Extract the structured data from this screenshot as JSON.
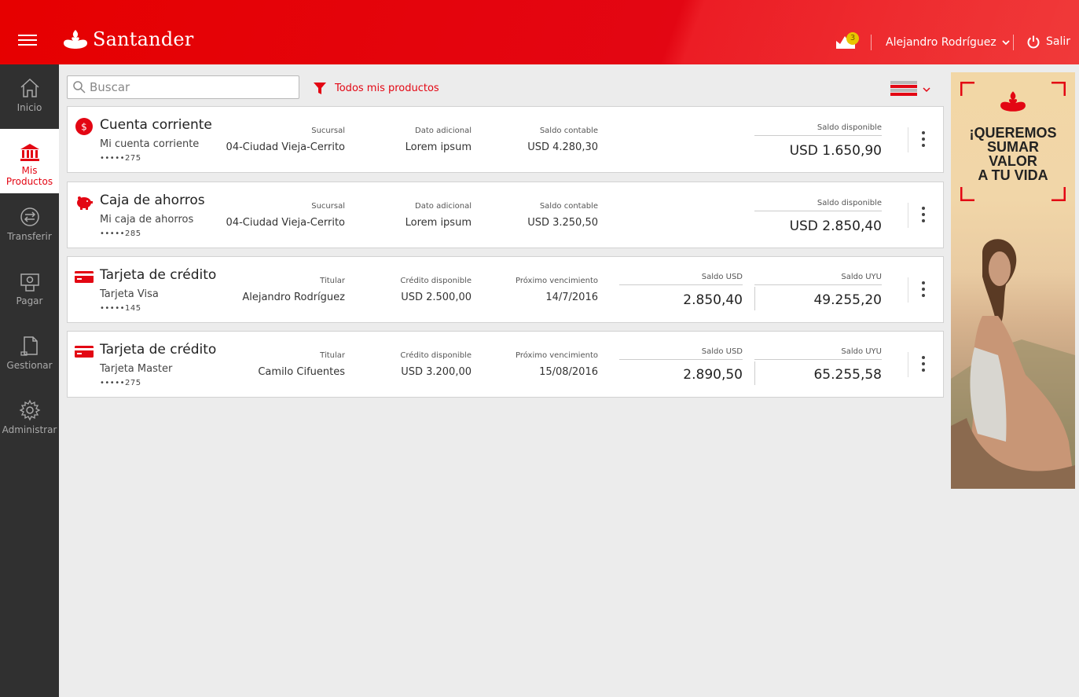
{
  "header": {
    "brand": "Santander",
    "notifications_count": "3",
    "user_name": "Alejandro Rodríguez",
    "logout_label": "Salir"
  },
  "sidebar": {
    "items": [
      {
        "label": "Inicio",
        "icon": "home-icon",
        "active": false
      },
      {
        "label": "Mis Productos",
        "icon": "bank-icon",
        "active": true
      },
      {
        "label": "Transferir",
        "icon": "transfer-icon",
        "active": false
      },
      {
        "label": "Pagar",
        "icon": "pay-icon",
        "active": false
      },
      {
        "label": "Gestionar",
        "icon": "document-icon",
        "active": false
      },
      {
        "label": "Administrar",
        "icon": "gear-icon",
        "active": false
      }
    ]
  },
  "toolbar": {
    "search_placeholder": "Buscar",
    "filter_label": "Todos mis productos"
  },
  "products": [
    {
      "title": "Cuenta corriente",
      "subtitle": "Mi cuenta corriente",
      "account": "•••••275",
      "icon": "dollar-icon",
      "col1_label": "Sucursal",
      "col1_value": "04-Ciudad Vieja-Cerrito",
      "col2_label": "Dato adicional",
      "col2_value": "Lorem ipsum",
      "col3_label": "Saldo contable",
      "col3_value": "USD 4.280,30",
      "bal1_label": "Saldo disponible",
      "bal1_value": "USD 1.650,90"
    },
    {
      "title": "Caja de ahorros",
      "subtitle": "Mi caja de ahorros",
      "account": "•••••285",
      "icon": "piggy-bank-icon",
      "col1_label": "Sucursal",
      "col1_value": "04-Ciudad Vieja-Cerrito",
      "col2_label": "Dato adicional",
      "col2_value": "Lorem ipsum",
      "col3_label": "Saldo contable",
      "col3_value": "USD 3.250,50",
      "bal1_label": "Saldo disponible",
      "bal1_value": "USD 2.850,40"
    },
    {
      "title": "Tarjeta de crédito",
      "subtitle": "Tarjeta Visa",
      "account": "•••••145",
      "icon": "credit-card-icon",
      "col1_label": "Titular",
      "col1_value": "Alejandro Rodríguez",
      "col2_label": "Crédito disponible",
      "col2_value": "USD 2.500,00",
      "col3_label": "Próximo vencimiento",
      "col3_value": "14/7/2016",
      "bal1_label": "Saldo USD",
      "bal1_value": "2.850,40",
      "bal2_label": "Saldo UYU",
      "bal2_value": "49.255,20"
    },
    {
      "title": "Tarjeta de crédito",
      "subtitle": "Tarjeta Master",
      "account": "•••••275",
      "icon": "credit-card-icon",
      "col1_label": "Titular",
      "col1_value": "Camilo Cifuentes",
      "col2_label": "Crédito disponible",
      "col2_value": "USD 3.200,00",
      "col3_label": "Próximo vencimiento",
      "col3_value": "15/08/2016",
      "bal1_label": "Saldo USD",
      "bal1_value": "2.890,50",
      "bal2_label": "Saldo UYU",
      "bal2_value": "65.255,58"
    }
  ],
  "ad": {
    "line1": "¡QUEREMOS",
    "line2": "SUMAR",
    "line3": "VALOR",
    "line4": "A TU VIDA"
  },
  "colors": {
    "brand_red": "#e30613",
    "sidebar_bg": "#303030",
    "page_bg": "#ececec"
  }
}
